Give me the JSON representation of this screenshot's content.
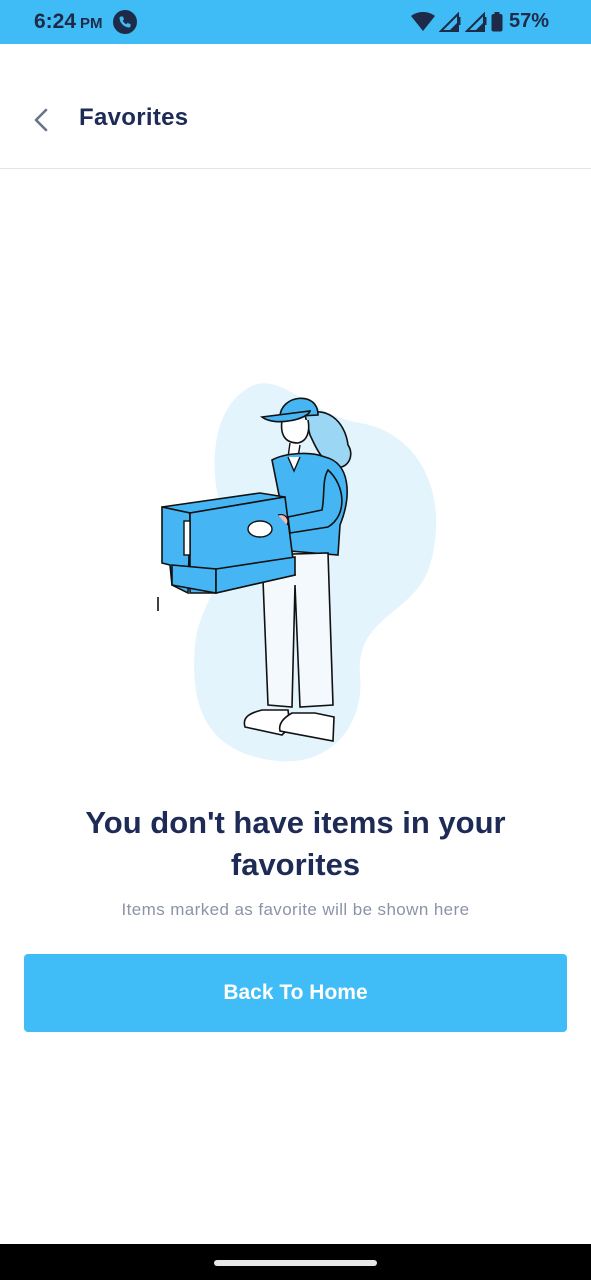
{
  "status_bar": {
    "time": "6:24",
    "ampm": "PM",
    "battery": "57%",
    "icons": [
      "call-icon",
      "wifi-icon",
      "signal-icon",
      "signal-icon",
      "battery-icon"
    ]
  },
  "header": {
    "title": "Favorites",
    "back_icon": "chevron-left-icon"
  },
  "empty_state": {
    "title": "You don't have items in your favorites",
    "subtitle": "Items marked as favorite will be shown here",
    "illustration": "person-holding-box-illustration"
  },
  "actions": {
    "back_home_label": "Back To Home"
  },
  "colors": {
    "status_bar": "#3fbbf5",
    "accent": "#40bdf6",
    "title_text": "#1d2b56",
    "subtitle_text": "#8b94a7",
    "illustration_bg": "#e3f4fd"
  }
}
